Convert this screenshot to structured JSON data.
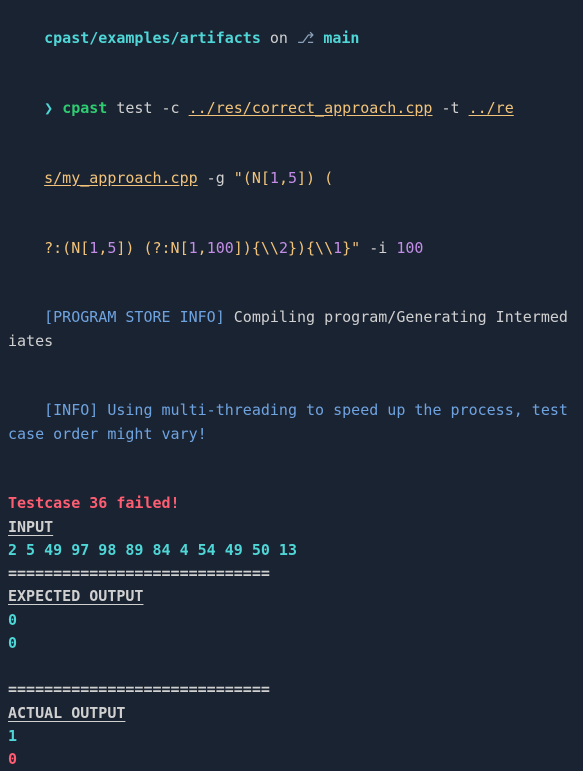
{
  "prompt_line": {
    "cwd": "cpast/examples/artifacts",
    "on": " on ",
    "branch_icon": "⎇ ",
    "branch": "main",
    "prompt_symbol": "❯ ",
    "exe": "cpast",
    "cmd_sub": " test ",
    "flag_c": "-c ",
    "file_c": "../res/correct_approach.cpp",
    "flag_t": " -t ",
    "file_t_part1": "../re",
    "file_t_part2": "s/my_approach.cpp",
    "flag_g": " -g ",
    "gen_str_1": "\"(N[",
    "gen_num_1": "1",
    "gen_str_2": ",",
    "gen_num_2": "5",
    "gen_str_3": "]) (",
    "gen_line3_a": "?:(N[",
    "gen_line3_b": "1",
    "gen_line3_c": ",",
    "gen_line3_d": "5",
    "gen_line3_e": "]) (?:N[",
    "gen_line3_f": "1",
    "gen_line3_g": ",",
    "gen_line3_h": "100",
    "gen_line3_i": "]){\\\\",
    "gen_line3_j": "2",
    "gen_line3_k": "}){\\\\",
    "gen_line3_l": "1",
    "gen_line3_m": "}\"",
    "flag_i": " -i ",
    "iter": "100"
  },
  "log": {
    "prog_tag": "[PROGRAM STORE INFO]",
    "prog_body": " Compiling program/Generating Intermediates",
    "info_tag": "[INFO]",
    "info_body": " Using multi-threading to speed up the process, testcase order might vary!"
  },
  "fail": {
    "headline": "Testcase 36 failed!",
    "input_hdr": "INPUT",
    "input_data": "2 5 49 97 98 89 84 4 54 49 50 13",
    "sep": "=============================",
    "exp_hdr": "EXPECTED OUTPUT",
    "exp_line1": "0",
    "exp_line2": "0",
    "act_hdr": "ACTUAL OUTPUT",
    "act_line1": "1",
    "act_line2": "0"
  }
}
